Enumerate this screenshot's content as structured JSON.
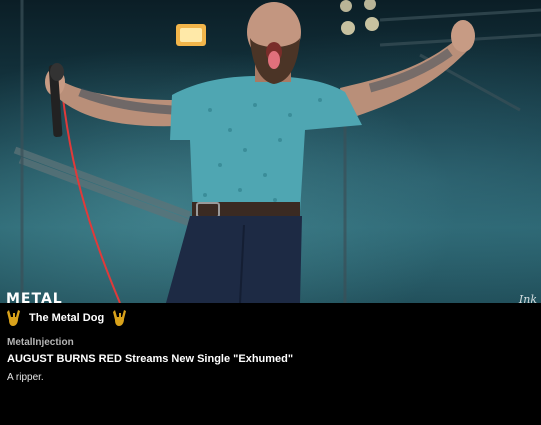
{
  "post": {
    "image": {
      "description": "",
      "watermark_left": "METAL",
      "watermark_right": "Ink"
    },
    "author": {
      "name": "The Metal Dog",
      "badge_icon": "horns-icon"
    },
    "source": "MetalInjection",
    "headline": "AUGUST BURNS RED Streams New Single \"Exhumed\"",
    "summary": "A ripper."
  },
  "colors": {
    "background": "#000000",
    "text": "#ffffff",
    "source_text": "#b5b5b5",
    "badge": "#d9a21b",
    "shirt": "#4fa6b2"
  }
}
